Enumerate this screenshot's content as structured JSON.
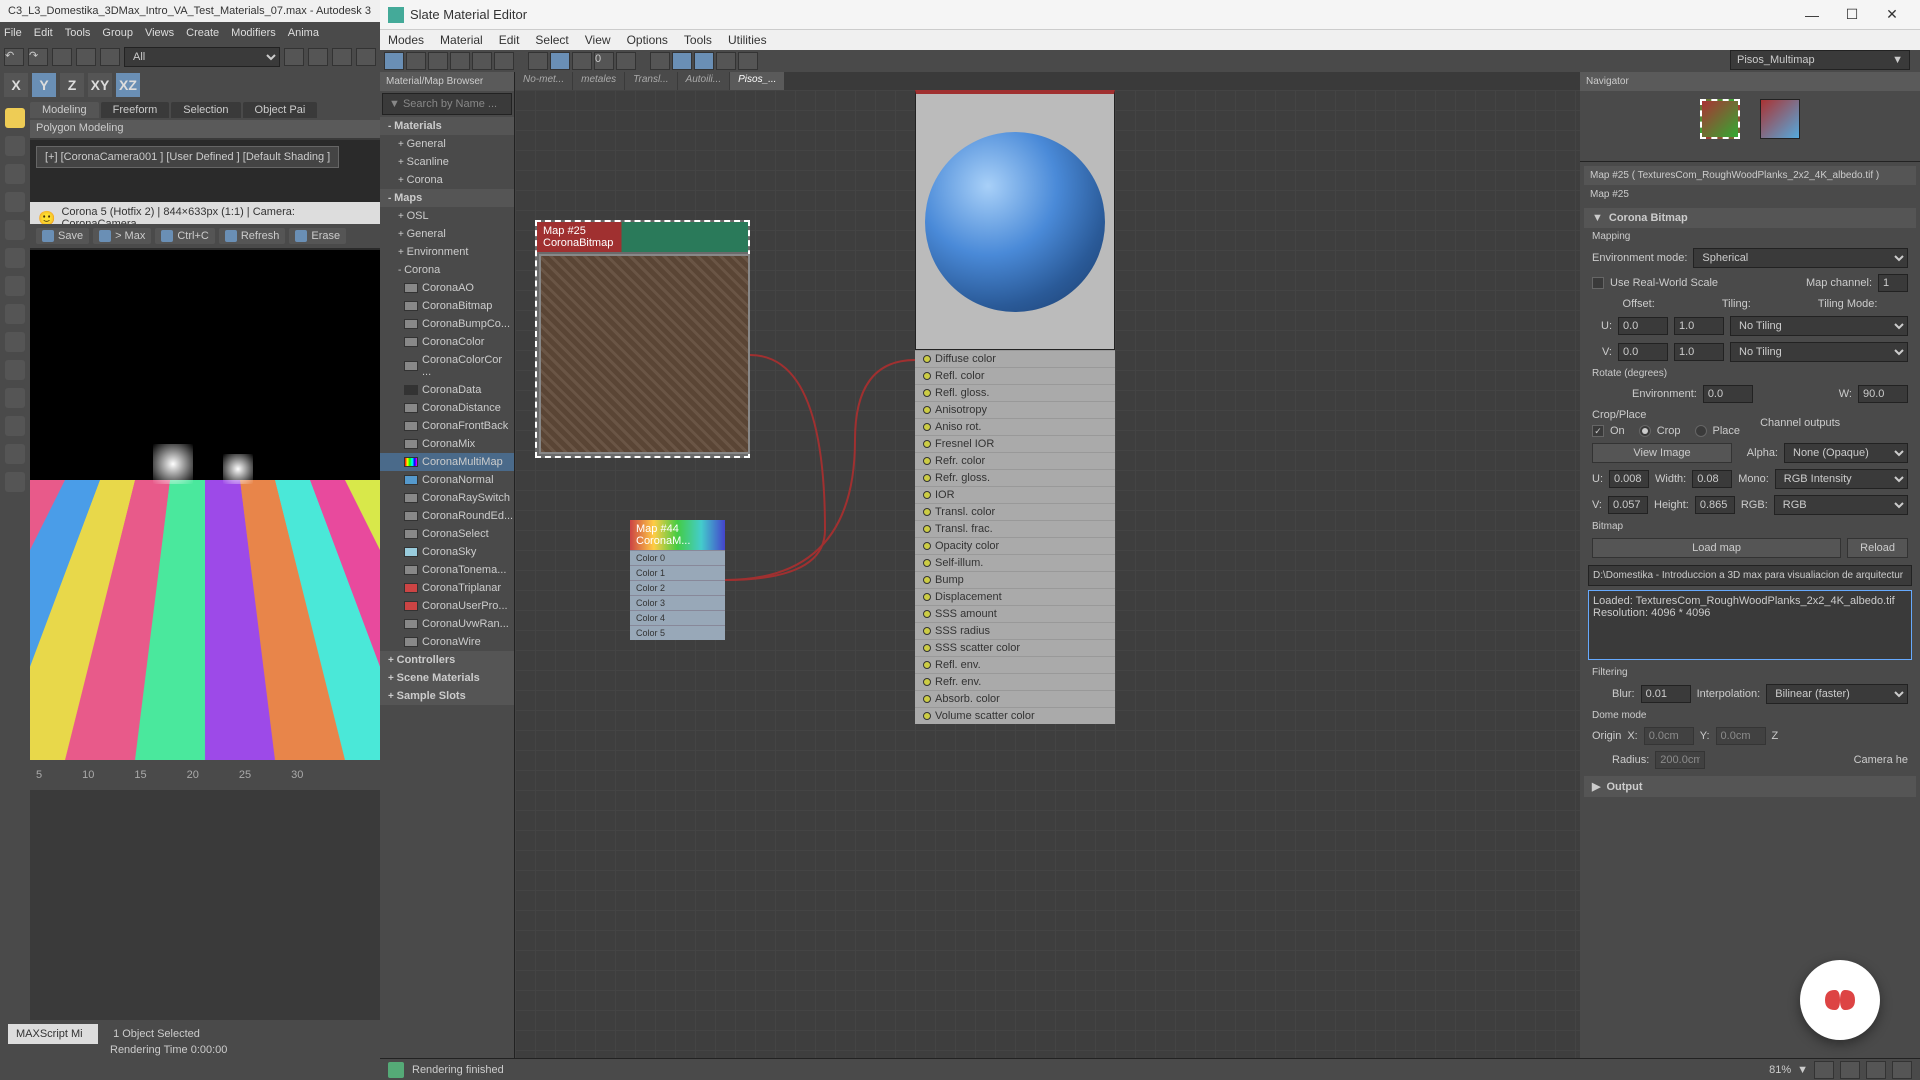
{
  "main_window": {
    "title": "C3_L3_Domestika_3DMax_Intro_VA_Test_Materials_07.max - Autodesk 3",
    "menu": [
      "File",
      "Edit",
      "Tools",
      "Group",
      "Views",
      "Create",
      "Modifiers",
      "Anima"
    ],
    "dropdown_all": "All",
    "coord": {
      "x": "X",
      "y": "Y",
      "z": "Z",
      "xy": "XY",
      "xz": "XZ"
    },
    "tabs": [
      "Modeling",
      "Freeform",
      "Selection",
      "Object Pai"
    ],
    "poly_label": "Polygon Modeling",
    "vp_label": "[+] [CoronaCamera001 ] [User Defined ] [Default Shading ]",
    "vp_status": "Corona 5 (Hotfix 2) | 844×633px (1:1) | Camera: CoronaCamera",
    "actions": {
      "save": "Save",
      "max": "> Max",
      "ctrlc": "Ctrl+C",
      "refresh": "Refresh",
      "erase": "Erase"
    },
    "timeline_marks": [
      "5",
      "10",
      "15",
      "20",
      "25",
      "30"
    ],
    "maxscript": "MAXScript Mi",
    "objects_selected": "1 Object Selected",
    "render_time": "Rendering Time  0:00:00"
  },
  "slate": {
    "title": "Slate Material Editor",
    "menu": [
      "Modes",
      "Material",
      "Edit",
      "Select",
      "View",
      "Options",
      "Tools",
      "Utilities"
    ],
    "material_dropdown": "Pisos_Multimap",
    "view_tabs": [
      "No-met...",
      "metales",
      "Transl...",
      "Autoili...",
      "Pisos_..."
    ],
    "render_status": "Rendering finished",
    "zoom": "81%"
  },
  "browser": {
    "title": "Material/Map Browser",
    "search_placeholder": "Search by Name ...",
    "tree": {
      "materials": "Materials",
      "materials_children": [
        "General",
        "Scanline",
        "Corona"
      ],
      "maps": "Maps",
      "maps_children": {
        "osl": "OSL",
        "general": "General",
        "environment": "Environment",
        "corona": "Corona",
        "corona_items": [
          "CoronaAO",
          "CoronaBitmap",
          "CoronaBumpCo...",
          "CoronaColor",
          "CoronaColorCor ...",
          "CoronaData",
          "CoronaDistance",
          "CoronaFrontBack",
          "CoronaMix",
          "CoronaMultiMap",
          "CoronaNormal",
          "CoronaRaySwitch",
          "CoronaRoundEd...",
          "CoronaSelect",
          "CoronaSky",
          "CoronaTonema...",
          "CoronaTriplanar",
          "CoronaUserPro...",
          "CoronaUvwRan...",
          "CoronaWire"
        ]
      },
      "controllers": "Controllers",
      "scene_materials": "Scene Materials",
      "sample_slots": "Sample Slots"
    }
  },
  "nodes": {
    "bitmap": {
      "title": "Map #25",
      "subtitle": "CoronaBitmap"
    },
    "multi": {
      "title": "Map #44",
      "subtitle": "CoronaM...",
      "rows": [
        "Color 0",
        "Color 1",
        "Color 2",
        "Color 3",
        "Color 4",
        "Color 5"
      ]
    },
    "material_params": [
      "Diffuse color",
      "Refl. color",
      "Refl. gloss.",
      "Anisotropy",
      "Aniso rot.",
      "Fresnel IOR",
      "Refr. color",
      "Refr. gloss.",
      "IOR",
      "Transl. color",
      "Transl. frac.",
      "Opacity color",
      "Self-illum.",
      "Bump",
      "Displacement",
      "SSS amount",
      "SSS radius",
      "SSS scatter color",
      "Refl. env.",
      "Refr. env.",
      "Absorb. color",
      "Volume scatter color"
    ]
  },
  "navigator": {
    "title": "Navigator"
  },
  "props": {
    "header": "Map #25 ( TexturesCom_RoughWoodPlanks_2x2_4K_albedo.tif )",
    "subheader": "Map #25",
    "sections": {
      "corona_bitmap": "Corona Bitmap",
      "mapping": "Mapping",
      "crop_place": "Crop/Place",
      "channel_outputs": "Channel outputs",
      "bitmap": "Bitmap",
      "filtering": "Filtering",
      "dome_mode": "Dome mode",
      "output": "Output"
    },
    "mapping": {
      "env_mode_label": "Environment mode:",
      "env_mode_value": "Spherical",
      "use_rw_scale": "Use Real-World Scale",
      "map_channel_label": "Map channel:",
      "map_channel": "1",
      "offset": "Offset:",
      "tiling": "Tiling:",
      "tiling_mode": "Tiling Mode:",
      "u": "U:",
      "v": "V:",
      "u_offset": "0.0",
      "v_offset": "0.0",
      "u_tiling": "1.0",
      "v_tiling": "1.0",
      "u_mode": "No Tiling",
      "v_mode": "No Tiling",
      "rotate": "Rotate (degrees)",
      "environment": "Environment:",
      "env_val": "0.0",
      "w": "W:",
      "w_val": "90.0"
    },
    "crop": {
      "on": "On",
      "crop": "Crop",
      "place": "Place",
      "view_image": "View Image",
      "u": "U:",
      "u_val": "0.008",
      "width": "Width:",
      "width_val": "0.08",
      "v": "V:",
      "v_val": "0.057",
      "height": "Height:",
      "height_val": "0.865"
    },
    "channel": {
      "alpha": "Alpha:",
      "alpha_val": "None (Opaque)",
      "mono": "Mono:",
      "mono_val": "RGB Intensity",
      "rgb": "RGB:",
      "rgb_val": "RGB"
    },
    "bitmap": {
      "load": "Load map",
      "reload": "Reload",
      "path": "D:\\Domestika - Introduccion a 3D max para visualiacion de arquitectur",
      "loaded": "Loaded: TexturesCom_RoughWoodPlanks_2x2_4K_albedo.tif",
      "resolution": "Resolution: 4096 * 4096"
    },
    "filtering": {
      "blur": "Blur:",
      "blur_val": "0.01",
      "interp": "Interpolation:",
      "interp_val": "Bilinear (faster)"
    },
    "dome": {
      "origin": "Origin",
      "x": "X:",
      "y": "Y:",
      "z": "Z",
      "x_val": "0.0cm",
      "y_val": "0.0cm",
      "radius": "Radius:",
      "radius_val": "200.0cm",
      "camera_height": "Camera he"
    }
  }
}
